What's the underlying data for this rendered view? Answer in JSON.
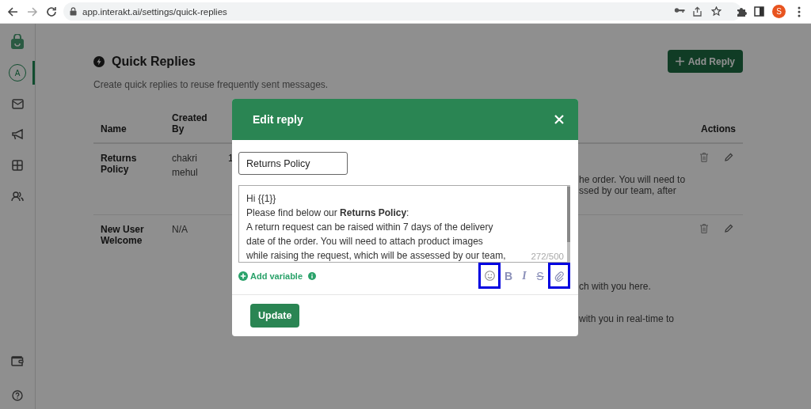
{
  "browser": {
    "url": "app.interakt.ai/settings/quick-replies",
    "profile_initial": "S"
  },
  "sidebar": {
    "top": [
      {
        "kind": "logo",
        "selected": false
      },
      {
        "kind": "avatar",
        "label": "A",
        "selected": true
      },
      {
        "kind": "mail",
        "selected": false
      },
      {
        "kind": "megaphone",
        "selected": false
      },
      {
        "kind": "grid",
        "selected": false
      },
      {
        "kind": "people",
        "selected": false
      }
    ],
    "bottom": [
      {
        "kind": "wallet",
        "selected": false
      },
      {
        "kind": "help",
        "selected": false
      }
    ]
  },
  "page": {
    "title": "Quick Replies",
    "subtitle": "Create quick replies to reuse frequently sent messages.",
    "add_button": "Add Reply"
  },
  "table": {
    "columns": [
      "Name",
      "Created By",
      "Actions"
    ],
    "rows": [
      {
        "name": "Returns Policy",
        "created_by": "chakri mehul",
        "column_3": "1",
        "message_lines": [
          "he order. You will need to",
          "ssed by our team, after"
        ]
      },
      {
        "name": "New User Welcome",
        "created_by": "N/A",
        "message_lines": [
          "ch with you here.",
          "with you in real-time to"
        ]
      }
    ]
  },
  "modal": {
    "title": "Edit reply",
    "name_value": "Returns Policy",
    "message": [
      "Hi {{1}}",
      "Please find below our **Returns Policy**:",
      "A return request can be raised within 7 days of the delivery",
      "date of the order. You will need to attach product images",
      "while raising the request, which will be assessed by our team,"
    ],
    "counter": "272/500",
    "add_variable": "Add variable",
    "tools": [
      {
        "kind": "emoji",
        "highlighted": true
      },
      {
        "kind": "bold",
        "glyph": "B",
        "highlighted": false
      },
      {
        "kind": "italic",
        "glyph": "I",
        "highlighted": false
      },
      {
        "kind": "strike",
        "glyph": "S",
        "highlighted": false
      },
      {
        "kind": "attach",
        "highlighted": true
      }
    ],
    "submit": "Update"
  }
}
